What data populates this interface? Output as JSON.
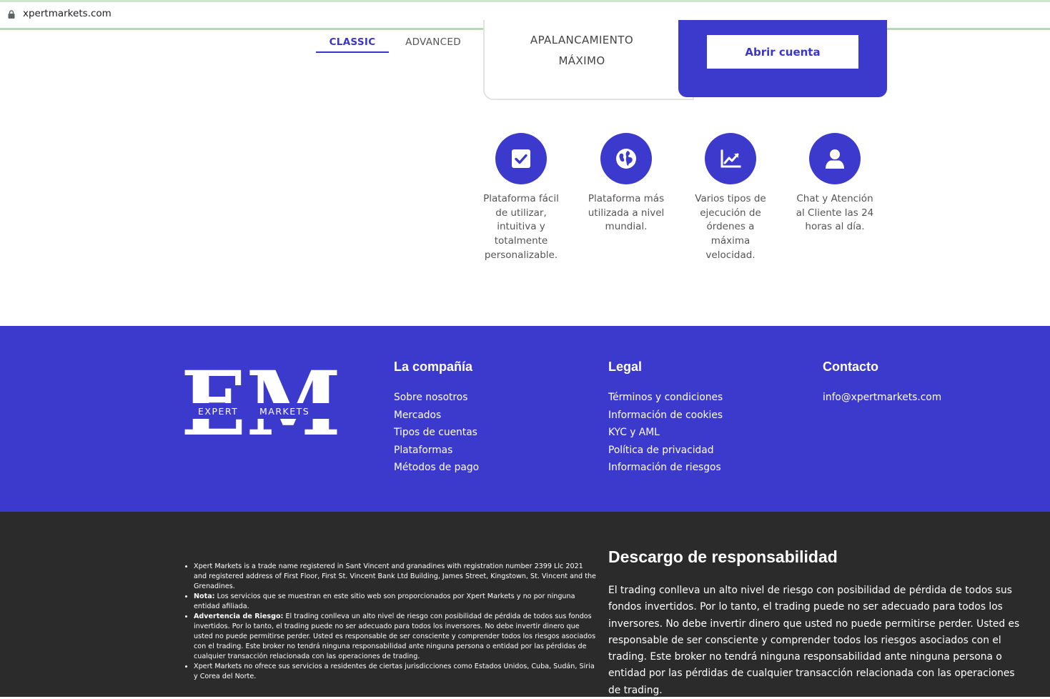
{
  "browser": {
    "url": "xpertmarkets.com"
  },
  "tabs": {
    "classic": "CLASSIC",
    "advanced": "ADVANCED"
  },
  "leverage_card": {
    "label_line1": "APALANCAMIENTO",
    "label_line2": "MÁXIMO"
  },
  "cta": {
    "label": "Abrir cuenta"
  },
  "features": [
    {
      "icon": "checkbox-icon",
      "text": "Plataforma fácil de utilizar, intuitiva y totalmente personalizable."
    },
    {
      "icon": "globe-icon",
      "text": "Plataforma más utilizada a nivel mundial."
    },
    {
      "icon": "chart-line-icon",
      "text": "Varios tipos de ejecución de órdenes a máxima velocidad."
    },
    {
      "icon": "user-icon",
      "text": "Chat y Atención al Cliente las 24 horas al día."
    }
  ],
  "footer": {
    "logo": {
      "letters": "EM",
      "word1": "EXPERT",
      "word2": "MARKETS"
    },
    "company": {
      "title": "La compañía",
      "links": [
        "Sobre nosotros",
        "Mercados",
        "Tipos de cuentas",
        "Plataformas",
        "Métodos de pago"
      ]
    },
    "legal": {
      "title": "Legal",
      "links": [
        "Términos y condiciones",
        "Información de cookies",
        "KYC y AML",
        "Política de privacidad",
        "Información de riesgos"
      ]
    },
    "contact": {
      "title": "Contacto",
      "email": "info@xpertmarkets.com"
    }
  },
  "notes": [
    {
      "bold": "",
      "text": "Xpert Markets is a trade name registered in Sant Vincent and granadines with registration number 2399 Llc 2021 and registered address of First Floor, First St. Vincent Bank Ltd Building, James Street, Kingstown, St. Vincent and the Grenadines."
    },
    {
      "bold": "Nota:",
      "text": " Los servicios que se muestran en este sitio web son proporcionados por Xpert Markets y no por ninguna entidad afiliada."
    },
    {
      "bold": "Advertencia de Riesgo:",
      "text": " El trading conlleva un alto nivel de riesgo con posibilidad de pérdida de todos sus fondos invertidos. Por lo tanto, el trading puede no ser adecuado para todos los inversores. No debe invertir dinero que usted no puede permitirse perder. Usted es responsable de ser consciente y comprender todos los riesgos asociados con el trading. Este broker no tendrá ninguna responsabilidad ante ninguna persona o entidad por las pérdidas de cualquier transacción relacionada con las operaciones de trading."
    },
    {
      "bold": "",
      "text": "Xpert Markets no ofrece sus servicios a residentes de ciertas jurisdicciones como Estados Unidos, Cuba, Sudán, Siria y Corea del Norte."
    }
  ],
  "disclaimer": {
    "title": "Descargo de responsabilidad",
    "body": "El trading conlleva un alto nivel de riesgo con posibilidad de pérdida de todos sus fondos invertidos. Por lo tanto, el trading puede no ser adecuado para todos los inversores. No debe invertir dinero que usted no puede permitirse perder. Usted es responsable de ser consciente y comprender todos los riesgos asociados con el trading. Este broker no tendrá ninguna responsabilidad ante ninguna persona o entidad por las pérdidas de cualquier transacción relacionada con las operaciones de trading."
  },
  "colors": {
    "brand": "#3c3acd",
    "dark_bg": "#2b2b2b"
  }
}
